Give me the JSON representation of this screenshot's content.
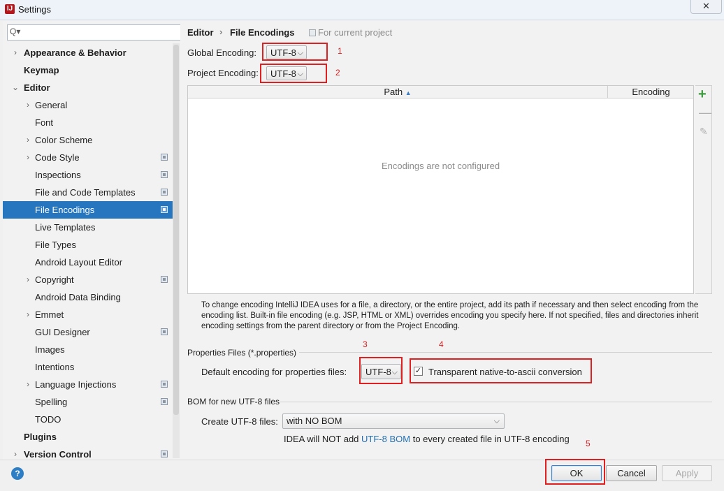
{
  "window": {
    "title": "Settings",
    "app_icon_text": "IJ",
    "close_glyph": "✕"
  },
  "search": {
    "value": "",
    "icon_glyph": "Q▾"
  },
  "tree": [
    {
      "label": "Appearance & Behavior",
      "bold": true,
      "chevron": "›",
      "level": 0
    },
    {
      "label": "Keymap",
      "bold": true,
      "chevron": "",
      "level": 0
    },
    {
      "label": "Editor",
      "bold": true,
      "chevron": "⌄",
      "level": 0
    },
    {
      "label": "General",
      "bold": false,
      "chevron": "›",
      "level": 1
    },
    {
      "label": "Font",
      "bold": false,
      "chevron": "",
      "level": 1
    },
    {
      "label": "Color Scheme",
      "bold": false,
      "chevron": "›",
      "level": 1
    },
    {
      "label": "Code Style",
      "bold": false,
      "chevron": "›",
      "level": 1,
      "project": true
    },
    {
      "label": "Inspections",
      "bold": false,
      "chevron": "",
      "level": 1,
      "project": true
    },
    {
      "label": "File and Code Templates",
      "bold": false,
      "chevron": "",
      "level": 1,
      "project": true
    },
    {
      "label": "File Encodings",
      "bold": false,
      "chevron": "",
      "level": 1,
      "project": true,
      "selected": true
    },
    {
      "label": "Live Templates",
      "bold": false,
      "chevron": "",
      "level": 1
    },
    {
      "label": "File Types",
      "bold": false,
      "chevron": "",
      "level": 1
    },
    {
      "label": "Android Layout Editor",
      "bold": false,
      "chevron": "",
      "level": 1
    },
    {
      "label": "Copyright",
      "bold": false,
      "chevron": "›",
      "level": 1,
      "project": true
    },
    {
      "label": "Android Data Binding",
      "bold": false,
      "chevron": "",
      "level": 1
    },
    {
      "label": "Emmet",
      "bold": false,
      "chevron": "›",
      "level": 1
    },
    {
      "label": "GUI Designer",
      "bold": false,
      "chevron": "",
      "level": 1,
      "project": true
    },
    {
      "label": "Images",
      "bold": false,
      "chevron": "",
      "level": 1
    },
    {
      "label": "Intentions",
      "bold": false,
      "chevron": "",
      "level": 1
    },
    {
      "label": "Language Injections",
      "bold": false,
      "chevron": "›",
      "level": 1,
      "project": true
    },
    {
      "label": "Spelling",
      "bold": false,
      "chevron": "",
      "level": 1,
      "project": true
    },
    {
      "label": "TODO",
      "bold": false,
      "chevron": "",
      "level": 1
    },
    {
      "label": "Plugins",
      "bold": true,
      "chevron": "",
      "level": 0
    },
    {
      "label": "Version Control",
      "bold": true,
      "chevron": "›",
      "level": 0,
      "project": true
    }
  ],
  "breadcrumb": {
    "section": "Editor",
    "separator": "›",
    "page": "File Encodings",
    "scope": "For current project"
  },
  "global_encoding": {
    "label": "Global Encoding:",
    "value": "UTF-8",
    "marker": "1"
  },
  "project_encoding": {
    "label": "Project Encoding:",
    "value": "UTF-8",
    "marker": "2"
  },
  "table": {
    "col_path": "Path",
    "col_encoding": "Encoding",
    "sort_glyph": "▲",
    "empty_text": "Encodings are not configured",
    "add_glyph": "+",
    "remove_glyph": "—",
    "edit_glyph": "✎"
  },
  "description": "To change encoding IntelliJ IDEA uses for a file, a directory, or the entire project, add its path if necessary and then select encoding from the encoding list. Built-in file encoding (e.g. JSP, HTML or XML) overrides encoding you specify here. If not specified, files and directories inherit encoding settings from the parent directory or from the Project Encoding.",
  "properties": {
    "section_title": "Properties Files (*.properties)",
    "default_label": "Default encoding for properties files:",
    "default_value": "UTF-8",
    "marker_combo": "3",
    "marker_checkbox": "4",
    "transparent_label": "Transparent native-to-ascii conversion",
    "transparent_checked": true,
    "check_glyph": "✓"
  },
  "bom": {
    "section_title": "BOM for new UTF-8 files",
    "create_label": "Create UTF-8 files:",
    "create_value": "with NO BOM",
    "note_prefix": "IDEA will NOT add ",
    "note_link": "UTF-8 BOM",
    "note_suffix": " to every created file in UTF-8 encoding"
  },
  "footer": {
    "help_glyph": "?",
    "ok": "OK",
    "cancel": "Cancel",
    "apply": "Apply",
    "marker_ok": "5"
  },
  "colors": {
    "selection": "#2675bf",
    "annotation_red": "#e02020",
    "link": "#2470b3",
    "add_green": "#3c9b3c"
  }
}
